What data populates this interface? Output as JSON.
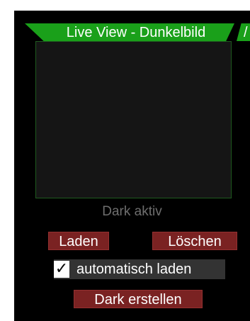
{
  "tab": {
    "title": "Live View - Dunkelbild",
    "next_mark": "/"
  },
  "status": "Dark aktiv",
  "buttons": {
    "load": "Laden",
    "delete": "Löschen",
    "create": "Dark erstellen"
  },
  "auto_load": {
    "checked": true,
    "check_glyph": "✓",
    "label": "automatisch laden"
  },
  "colors": {
    "tab_green": "#1aa01a",
    "button_red": "#7a2222",
    "panel_bg": "#000000",
    "status_gray": "#6e6e6e"
  }
}
